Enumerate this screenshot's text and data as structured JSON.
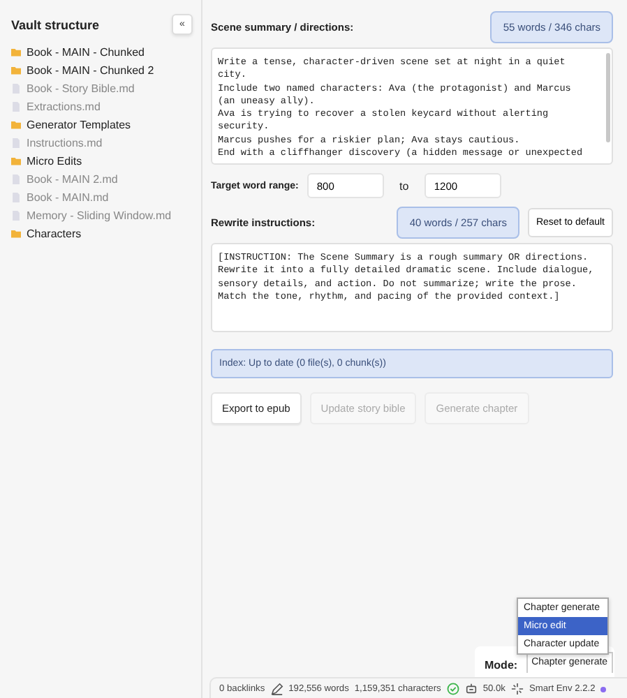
{
  "sidebar": {
    "title": "Vault structure",
    "collapse_button": "«",
    "items": [
      {
        "kind": "folder",
        "label": "Book - MAIN - Chunked"
      },
      {
        "kind": "folder",
        "label": "Book - MAIN - Chunked 2"
      },
      {
        "kind": "file",
        "label": "Book - Story Bible.md"
      },
      {
        "kind": "file",
        "label": "Extractions.md"
      },
      {
        "kind": "folder",
        "label": "Generator Templates"
      },
      {
        "kind": "file",
        "label": "Instructions.md"
      },
      {
        "kind": "folder",
        "label": "Micro Edits"
      },
      {
        "kind": "file",
        "label": "Book - MAIN 2.md"
      },
      {
        "kind": "file",
        "label": "Book - MAIN.md"
      },
      {
        "kind": "file",
        "label": "Memory - Sliding Window.md"
      },
      {
        "kind": "folder",
        "label": "Characters"
      }
    ]
  },
  "scene": {
    "label": "Scene summary / directions:",
    "count": "55 words / 346 chars",
    "value": "Write a tense, character-driven scene set at night in a quiet city.\nInclude two named characters: Ava (the protagonist) and Marcus (an uneasy ally).\nAva is trying to recover a stolen keycard without alerting security.\nMarcus pushes for a riskier plan; Ava stays cautious.\nEnd with a cliffhanger discovery (a hidden message or unexpected"
  },
  "word_range": {
    "label": "Target word range:",
    "min": "800",
    "separator": "to",
    "max": "1200"
  },
  "rewrite": {
    "label": "Rewrite instructions:",
    "count": "40 words / 257 chars",
    "reset_button": "Reset to default",
    "value": "[INSTRUCTION: The Scene Summary is a rough summary OR directions. Rewrite it into a fully detailed dramatic scene. Include dialogue, sensory details, and action. Do not summarize; write the prose. Match the tone, rhythm, and pacing of the provided context.]"
  },
  "index_status": "Index: Up to date (0 file(s), 0 chunk(s))",
  "buttons": [
    {
      "label": "Export to epub",
      "disabled": false
    },
    {
      "label": "Update story bible",
      "disabled": true
    },
    {
      "label": "Generate chapter",
      "disabled": true
    }
  ],
  "mode": {
    "label": "Mode:",
    "value": "Chapter generate",
    "options": [
      {
        "label": "Chapter generate",
        "highlighted": false
      },
      {
        "label": "Micro edit",
        "highlighted": true
      },
      {
        "label": "Character update",
        "highlighted": false
      }
    ]
  },
  "status_bar": {
    "backlinks": "0 backlinks",
    "words": "192,556 words",
    "characters": "1,159,351 characters",
    "tokens": "50.0k",
    "plugin": "Smart Env 2.2.2"
  }
}
